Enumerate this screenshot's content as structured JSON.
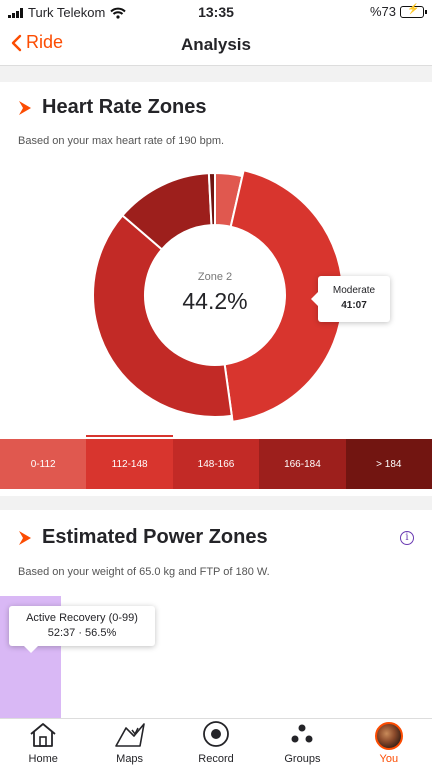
{
  "status": {
    "carrier": "Turk Telekom",
    "time": "13:35",
    "battery": "%73"
  },
  "nav": {
    "back_label": "Ride",
    "title": "Analysis"
  },
  "hr_section": {
    "title": "Heart Rate Zones",
    "subtitle": "Based on your max heart rate of 190 bpm.",
    "center_label": "Zone 2",
    "center_value": "44.2%",
    "tooltip": {
      "name": "Moderate",
      "time": "41:07"
    },
    "zones": [
      {
        "label": "0-112",
        "color": "#e0584f"
      },
      {
        "label": "112-148",
        "color": "#d8352e"
      },
      {
        "label": "148-166",
        "color": "#c22a26"
      },
      {
        "label": "166-184",
        "color": "#9d1f1c"
      },
      {
        "label": "> 184",
        "color": "#721511"
      }
    ],
    "selected_zone": 1
  },
  "chart_data": {
    "type": "pie",
    "title": "Heart Rate Zones",
    "categories": [
      "0-112",
      "112-148",
      "148-166",
      "166-184",
      "> 184"
    ],
    "values": [
      3.6,
      44.2,
      38.5,
      12.9,
      0.8
    ],
    "colors": [
      "#e0584f",
      "#d8352e",
      "#c22a26",
      "#9d1f1c",
      "#721511"
    ]
  },
  "power_section": {
    "title": "Estimated Power Zones",
    "subtitle": "Based on your weight of 65.0 kg and FTP of 180 W.",
    "tooltip": {
      "name": "Active Recovery (0-99)",
      "value": "52:37 · 56.5%"
    },
    "bar_color": "#d9b8f5"
  },
  "tabs": [
    {
      "label": "Home",
      "icon": "home-icon"
    },
    {
      "label": "Maps",
      "icon": "map-icon"
    },
    {
      "label": "Record",
      "icon": "record-icon"
    },
    {
      "label": "Groups",
      "icon": "groups-icon"
    },
    {
      "label": "You",
      "icon": "avatar"
    }
  ],
  "accent_color": "#fc4c02"
}
